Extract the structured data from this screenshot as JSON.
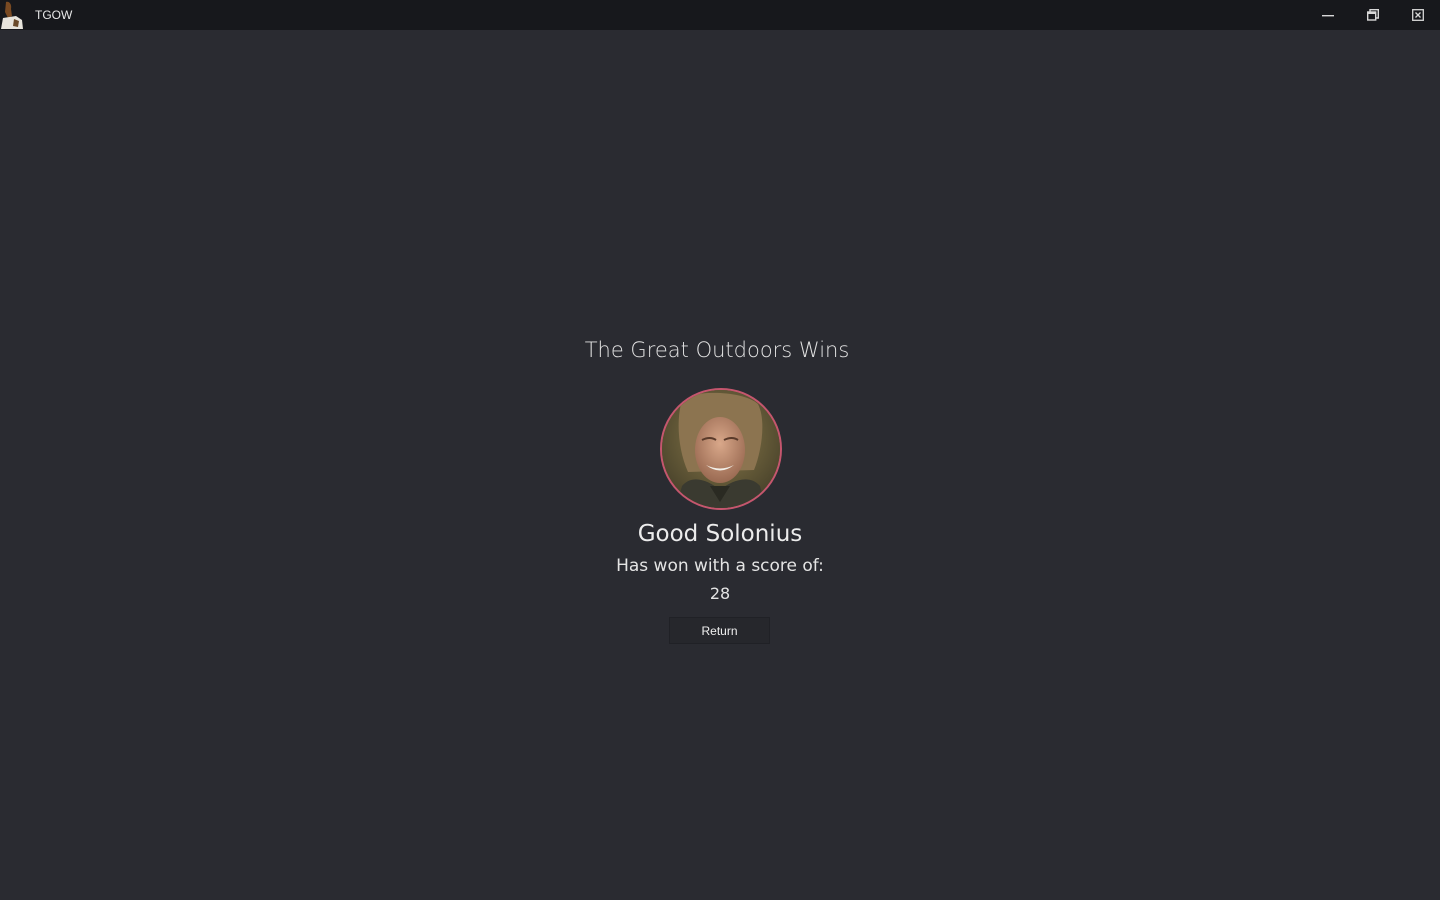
{
  "window": {
    "title": "TGOW",
    "controls": [
      "minimize-icon",
      "restore-icon",
      "close-icon"
    ]
  },
  "result": {
    "headline": "The Great Outdoors Wins",
    "player_name": "Good Solonius",
    "subtitle": "Has won with a score of:",
    "score": "28",
    "return_label": "Return"
  },
  "colors": {
    "background": "#2a2b31",
    "titlebar": "#17181c",
    "avatar_border": "#c5566e"
  }
}
